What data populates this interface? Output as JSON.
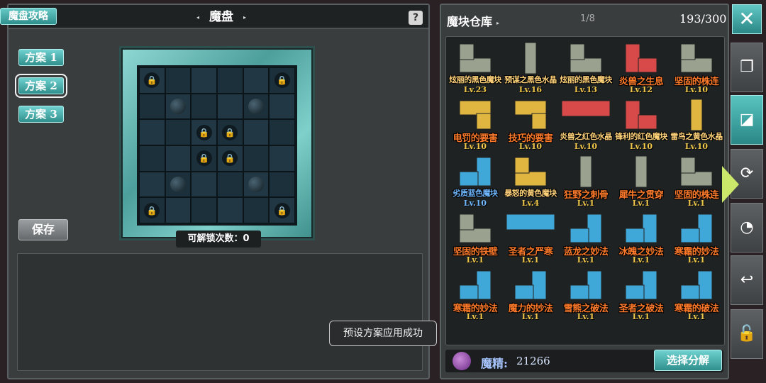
{
  "left_panel": {
    "guide_button": "魔盘攻略",
    "title": "魔盘",
    "help_label": "?",
    "plans": [
      "方案 1",
      "方案 2",
      "方案 3"
    ],
    "selected_plan_index": 1,
    "save_label": "保存",
    "unlock_label": "可解锁次数：",
    "unlock_count": "0",
    "board": {
      "size": 6,
      "locked_cells": [
        [
          0,
          0
        ],
        [
          0,
          5
        ],
        [
          2,
          2
        ],
        [
          2,
          3
        ],
        [
          3,
          2
        ],
        [
          3,
          3
        ],
        [
          5,
          0
        ],
        [
          5,
          5
        ]
      ],
      "orb_cells": [
        [
          1,
          1
        ],
        [
          1,
          4
        ],
        [
          4,
          1
        ],
        [
          4,
          4
        ]
      ]
    }
  },
  "toast": "预设方案应用成功",
  "right_panel": {
    "title": "魔块仓库",
    "page": "1/8",
    "capacity": "193/300",
    "blocks": [
      {
        "name": "炫丽的黑色魔块",
        "level": "Lv.23",
        "color": "#9aa28f",
        "shape": "L",
        "big": false,
        "name_color": "#ffd27a"
      },
      {
        "name": "预谋之黑色水晶",
        "level": "Lv.16",
        "color": "#9aa28f",
        "shape": "I",
        "big": false,
        "name_color": "#ffd27a"
      },
      {
        "name": "炫丽的黑色魔块",
        "level": "Lv.13",
        "color": "#9aa28f",
        "shape": "L",
        "big": false,
        "name_color": "#ffd27a"
      },
      {
        "name": "炎兽之生息",
        "level": "Lv.12",
        "color": "#d84a4a",
        "shape": "L2",
        "big": true,
        "name_color": "#ff7a2a"
      },
      {
        "name": "坚固的株连",
        "level": "Lv.10",
        "color": "#9aa28f",
        "shape": "L",
        "big": true,
        "name_color": "#ff7a2a"
      },
      {
        "name": "电罚的要害",
        "level": "Lv.10",
        "color": "#e0b640",
        "shape": "T",
        "big": true,
        "name_color": "#ff7a2a"
      },
      {
        "name": "技巧的要害",
        "level": "Lv.10",
        "color": "#e0b640",
        "shape": "T",
        "big": true,
        "name_color": "#ff7a2a"
      },
      {
        "name": "炎兽之红色水晶",
        "level": "Lv.10",
        "color": "#d84a4a",
        "shape": "H",
        "big": false,
        "name_color": "#ffd27a"
      },
      {
        "name": "锋利的红色魔块",
        "level": "Lv.10",
        "color": "#d84a4a",
        "shape": "L2",
        "big": false,
        "name_color": "#ffd27a"
      },
      {
        "name": "雷鸟之黄色水晶",
        "level": "Lv.10",
        "color": "#e0b640",
        "shape": "I",
        "big": false,
        "name_color": "#ffd27a"
      },
      {
        "name": "劣质蓝色魔块",
        "level": "Lv.10",
        "color": "#3fa8d8",
        "shape": "J",
        "big": false,
        "name_color": "#6fb7ff"
      },
      {
        "name": "暴怒的黄色魔块",
        "level": "Lv.4",
        "color": "#e0b640",
        "shape": "L",
        "big": false,
        "name_color": "#ffd27a"
      },
      {
        "name": "狂野之刺骨",
        "level": "Lv.1",
        "color": "#9aa28f",
        "shape": "I",
        "big": true,
        "name_color": "#ff7a2a"
      },
      {
        "name": "犀牛之贯穿",
        "level": "Lv.1",
        "color": "#9aa28f",
        "shape": "I",
        "big": true,
        "name_color": "#ff7a2a"
      },
      {
        "name": "坚固的株连",
        "level": "Lv.1",
        "color": "#9aa28f",
        "shape": "L",
        "big": true,
        "name_color": "#ff7a2a"
      },
      {
        "name": "坚固的铁壁",
        "level": "Lv.1",
        "color": "#9aa28f",
        "shape": "L",
        "big": true,
        "name_color": "#ff7a2a"
      },
      {
        "name": "圣者之严寒",
        "level": "Lv.1",
        "color": "#3fa8d8",
        "shape": "H",
        "big": true,
        "name_color": "#ff7a2a"
      },
      {
        "name": "蓝龙之妙法",
        "level": "Lv.1",
        "color": "#3fa8d8",
        "shape": "J",
        "big": true,
        "name_color": "#ff7a2a"
      },
      {
        "name": "冰魄之妙法",
        "level": "Lv.1",
        "color": "#3fa8d8",
        "shape": "J",
        "big": true,
        "name_color": "#ff7a2a"
      },
      {
        "name": "寒霜的妙法",
        "level": "Lv.1",
        "color": "#3fa8d8",
        "shape": "J",
        "big": true,
        "name_color": "#ff7a2a"
      },
      {
        "name": "寒霜的妙法",
        "level": "Lv.1",
        "color": "#3fa8d8",
        "shape": "J",
        "big": true,
        "name_color": "#ff7a2a"
      },
      {
        "name": "魔力的妙法",
        "level": "Lv.1",
        "color": "#3fa8d8",
        "shape": "J",
        "big": true,
        "name_color": "#ff7a2a"
      },
      {
        "name": "雪熊之破法",
        "level": "Lv.1",
        "color": "#3fa8d8",
        "shape": "J",
        "big": true,
        "name_color": "#ff7a2a"
      },
      {
        "name": "圣者之破法",
        "level": "Lv.1",
        "color": "#3fa8d8",
        "shape": "J",
        "big": true,
        "name_color": "#ff7a2a"
      },
      {
        "name": "寒霜的破法",
        "level": "Lv.1",
        "color": "#3fa8d8",
        "shape": "J",
        "big": true,
        "name_color": "#ff7a2a"
      }
    ],
    "essence_label": "魔精:",
    "essence_value": "21266",
    "decompose_label": "选择分解"
  },
  "sidebar": {
    "close_label": "✕",
    "buttons": [
      {
        "name": "stack-icon",
        "glyph": "❐",
        "active": false
      },
      {
        "name": "tile-icon",
        "glyph": "◪",
        "active": true
      },
      {
        "name": "refresh-up-icon",
        "glyph": "⟳",
        "active": false
      },
      {
        "name": "swap-icon",
        "glyph": "◔",
        "active": false
      },
      {
        "name": "back-arrow-icon",
        "glyph": "↩",
        "active": false
      },
      {
        "name": "unlock-icon",
        "glyph": "🔓",
        "active": false
      }
    ]
  }
}
